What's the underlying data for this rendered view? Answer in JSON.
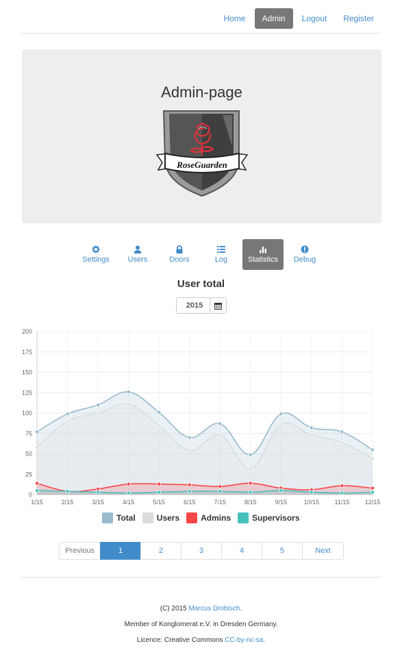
{
  "nav": {
    "items": [
      {
        "label": "Home",
        "active": false
      },
      {
        "label": "Admin",
        "active": true
      },
      {
        "label": "Logout",
        "active": false
      },
      {
        "label": "Register",
        "active": false
      }
    ]
  },
  "jumbotron": {
    "title": "Admin-page",
    "logo_text": "RoseGuarden"
  },
  "tabs": [
    {
      "label": "Settings",
      "icon": "gear-icon",
      "active": false
    },
    {
      "label": "Users",
      "icon": "user-icon",
      "active": false
    },
    {
      "label": "Doors",
      "icon": "lock-icon",
      "active": false
    },
    {
      "label": "Log",
      "icon": "list-icon",
      "active": false
    },
    {
      "label": "Statistics",
      "icon": "bar-chart-icon",
      "active": true
    },
    {
      "label": "Debug",
      "icon": "info-icon",
      "active": false
    }
  ],
  "section": {
    "title": "User total",
    "year": "2015"
  },
  "chart_data": {
    "type": "area",
    "categories": [
      "1/15",
      "2/15",
      "3/15",
      "4/15",
      "5/15",
      "6/15",
      "7/15",
      "8/15",
      "9/15",
      "10/15",
      "11/15",
      "12/15"
    ],
    "ylim": [
      0,
      200
    ],
    "yticks": [
      0,
      25,
      50,
      75,
      100,
      125,
      150,
      175,
      200
    ],
    "grid": true,
    "legend_position": "bottom",
    "series": [
      {
        "name": "Total",
        "color": "#97bbcd",
        "values": [
          77,
          99,
          110,
          126,
          101,
          70,
          87,
          49,
          99,
          82,
          77,
          55
        ]
      },
      {
        "name": "Users",
        "color": "#dcdcdc",
        "values": [
          58,
          90,
          100,
          111,
          85,
          54,
          73,
          32,
          86,
          73,
          64,
          44
        ]
      },
      {
        "name": "Admins",
        "color": "#f7464a",
        "values": [
          14,
          4,
          7,
          13,
          13,
          12,
          10,
          14,
          8,
          6,
          11,
          8
        ]
      },
      {
        "name": "Supervisors",
        "color": "#46bfbd",
        "values": [
          5,
          4,
          3,
          2,
          3,
          4,
          4,
          3,
          5,
          3,
          2,
          3
        ]
      }
    ]
  },
  "pagination": {
    "prev_label": "Previous",
    "pages": [
      "1",
      "2",
      "3",
      "4",
      "5"
    ],
    "current": "1",
    "next_label": "Next"
  },
  "footer": {
    "line1_prefix": "(C) 2015 ",
    "line1_link": "Marcus Drobisch",
    "line1_suffix": ".",
    "line2": "Member of Konglomerat e.V. in Dresden Germany.",
    "line3_prefix": "Licence: Creative Commons ",
    "line3_link": "CC-by-nc-sa",
    "line3_suffix": "."
  },
  "colors": {
    "accent": "#428bca",
    "active_tab_bg": "#777777",
    "jumbotron_bg": "#eeeeee"
  }
}
